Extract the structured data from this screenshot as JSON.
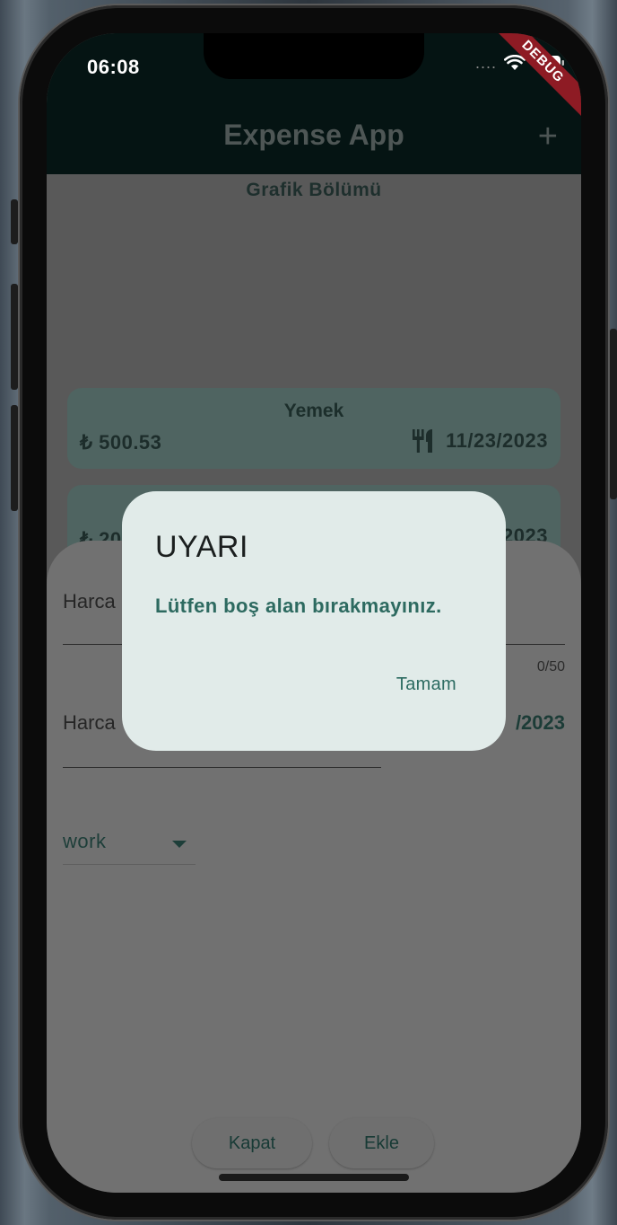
{
  "status": {
    "time": "06:08",
    "dots": "....",
    "debug_banner": "DEBUG"
  },
  "appbar": {
    "title": "Expense App",
    "add_icon": "plus-icon"
  },
  "chart_section": {
    "title": "Grafik Bölümü"
  },
  "expenses": [
    {
      "title": "Yemek",
      "amount": "₺ 500.53",
      "icon": "food-icon",
      "date": "11/23/2023"
    },
    {
      "title": "",
      "amount": "₺ 20",
      "date": "11/23/2023"
    }
  ],
  "sheet": {
    "title_field_label": "Harca",
    "title_counter": "0/50",
    "amount_field_label": "Harca",
    "date_value": "/2023",
    "category_selected": "work",
    "close_button": "Kapat",
    "add_button": "Ekle"
  },
  "dialog": {
    "title": "UYARI",
    "message": "Lütfen boş alan bırakmayınız.",
    "ok_button": "Tamam"
  }
}
